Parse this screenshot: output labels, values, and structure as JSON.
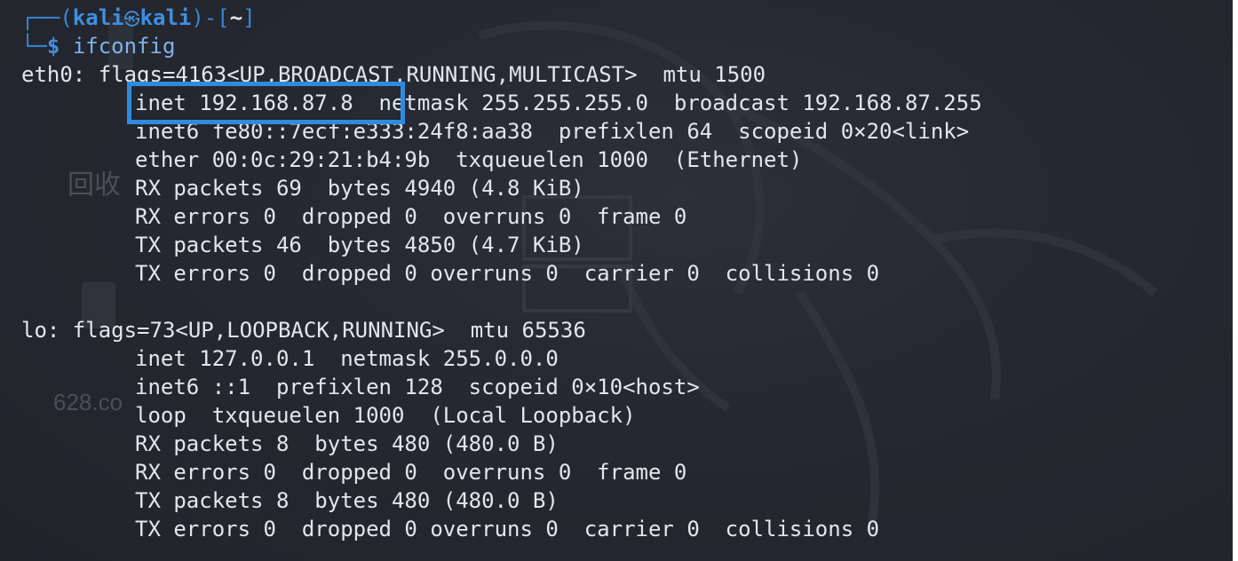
{
  "prompt": {
    "corner_top": "┌──(",
    "user": "kali",
    "skull_icon": "㉿",
    "host": "kali",
    "bracket_mid": ")-[",
    "cwd": "~",
    "bracket_end": "]",
    "corner_bottom": "└─",
    "dollar": "$",
    "command": "ifconfig"
  },
  "output": {
    "eth0": {
      "header": "eth0: flags=4163<UP,BROADCAST,RUNNING,MULTICAST>  mtu 1500",
      "inet": "inet 192.168.87.8  netmask 255.255.255.0  broadcast 192.168.87.255",
      "inet6": "inet6 fe80::7ecf:e333:24f8:aa38  prefixlen 64  scopeid 0×20<link>",
      "ether": "ether 00:0c:29:21:b4:9b  txqueuelen 1000  (Ethernet)",
      "rx_packets": "RX packets 69  bytes 4940 (4.8 KiB)",
      "rx_errors": "RX errors 0  dropped 0  overruns 0  frame 0",
      "tx_packets": "TX packets 46  bytes 4850 (4.7 KiB)",
      "tx_errors": "TX errors 0  dropped 0 overruns 0  carrier 0  collisions 0"
    },
    "lo": {
      "header": "lo: flags=73<UP,LOOPBACK,RUNNING>  mtu 65536",
      "inet": "inet 127.0.0.1  netmask 255.0.0.0",
      "inet6": "inet6 ::1  prefixlen 128  scopeid 0×10<host>",
      "loop": "loop  txqueuelen 1000  (Local Loopback)",
      "rx_packets": "RX packets 8  bytes 480 (480.0 B)",
      "rx_errors": "RX errors 0  dropped 0  overruns 0  frame 0",
      "tx_packets": "TX packets 8  bytes 480 (480.0 B)",
      "tx_errors": "TX errors 0  dropped 0 overruns 0  carrier 0  collisions 0"
    }
  },
  "watermark": {
    "text_recycle": "回收",
    "text_628": "628.co"
  },
  "colors": {
    "background": "#23262e",
    "text": "#e3e6ec",
    "accent_blue": "#3f8fe0",
    "highlight_box": "#2e8bde"
  }
}
